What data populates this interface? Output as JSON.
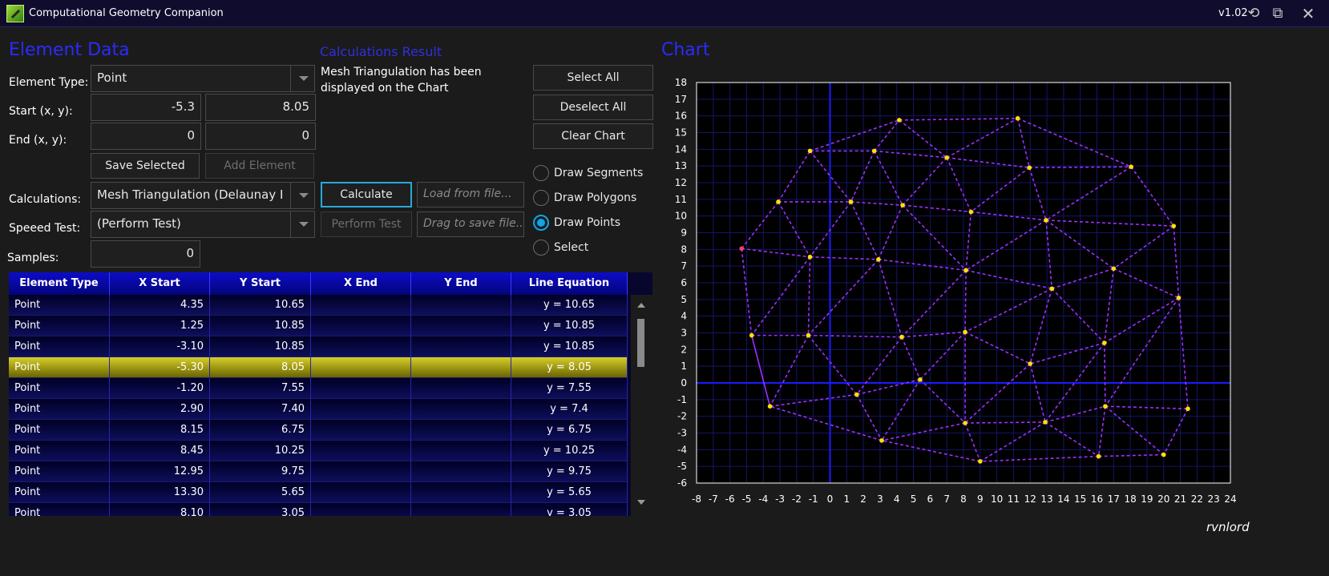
{
  "window": {
    "title": "Computational Geometry Companion",
    "version": "v1.02",
    "controls": [
      "refresh-icon",
      "snap-icon",
      "close-icon"
    ]
  },
  "element_data": {
    "heading": "Element Data",
    "element_type_label": "Element Type:",
    "element_type_value": "Point",
    "start_label": "Start (x, y):",
    "start_x": "-5.3",
    "start_y": "8.05",
    "end_label": "End (x, y):",
    "end_x": "0",
    "end_y": "0",
    "save_selected": "Save Selected",
    "add_element": "Add Element",
    "calculations_label": "Calculations:",
    "calculations_value": "Mesh Triangulation (Delaunay Iterative)",
    "speed_test_label": "Speeed Test:",
    "speed_test_value": "(Perform Test)",
    "samples_label": "Samples:",
    "samples_value": "0"
  },
  "results": {
    "heading": "Calculations Result",
    "message": "Mesh Triangulation has been displayed on the Chart",
    "calculate": "Calculate",
    "perform_test": "Perform Test",
    "load_placeholder": "Load from file...",
    "save_placeholder": "Drag to save file..."
  },
  "actions": {
    "select_all": "Select All",
    "deselect_all": "Deselect All",
    "clear_chart": "Clear Chart",
    "modes": [
      {
        "label": "Draw Segments",
        "checked": false
      },
      {
        "label": "Draw Polygons",
        "checked": false
      },
      {
        "label": "Draw Points",
        "checked": true
      },
      {
        "label": "Select",
        "checked": false
      }
    ]
  },
  "table": {
    "columns": [
      "Element Type",
      "X Start",
      "Y Start",
      "X End",
      "Y End",
      "Line Equation"
    ],
    "rows": [
      [
        "Point",
        "4.35",
        "10.65",
        "",
        "",
        "y = 10.65"
      ],
      [
        "Point",
        "1.25",
        "10.85",
        "",
        "",
        "y = 10.85"
      ],
      [
        "Point",
        "-3.10",
        "10.85",
        "",
        "",
        "y = 10.85"
      ],
      [
        "Point",
        "-5.30",
        "8.05",
        "",
        "",
        "y = 8.05"
      ],
      [
        "Point",
        "-1.20",
        "7.55",
        "",
        "",
        "y = 7.55"
      ],
      [
        "Point",
        "2.90",
        "7.40",
        "",
        "",
        "y = 7.4"
      ],
      [
        "Point",
        "8.15",
        "6.75",
        "",
        "",
        "y = 6.75"
      ],
      [
        "Point",
        "8.45",
        "10.25",
        "",
        "",
        "y = 10.25"
      ],
      [
        "Point",
        "12.95",
        "9.75",
        "",
        "",
        "y = 9.75"
      ],
      [
        "Point",
        "13.30",
        "5.65",
        "",
        "",
        "y = 5.65"
      ],
      [
        "Point",
        "8.10",
        "3.05",
        "",
        "",
        "y = 3.05"
      ]
    ],
    "selected_row": 3
  },
  "chart": {
    "heading": "Chart",
    "author": "rvnlord"
  },
  "colors": {
    "accent": "#2b2bff",
    "edge": "#9b30ff",
    "point": "#ffe100",
    "selected_point": "#ff4060",
    "axis": "#1a1aff",
    "grid": "#15156a"
  },
  "chart_data": {
    "type": "scatter",
    "xlim": [
      -8,
      24
    ],
    "ylim": [
      -6,
      18
    ],
    "x_ticks": [
      -8,
      -7,
      -6,
      -5,
      -4,
      -3,
      -2,
      -1,
      0,
      1,
      2,
      3,
      4,
      5,
      6,
      7,
      8,
      9,
      10,
      11,
      12,
      13,
      14,
      15,
      16,
      17,
      18,
      19,
      20,
      21,
      22,
      23,
      24
    ],
    "y_ticks": [
      -6,
      -5,
      -4,
      -3,
      -2,
      -1,
      0,
      1,
      2,
      3,
      4,
      5,
      6,
      7,
      8,
      9,
      10,
      11,
      12,
      13,
      14,
      15,
      16,
      17,
      18
    ],
    "grid": true,
    "points": [
      [
        -5.3,
        8.05
      ],
      [
        -3.1,
        10.85
      ],
      [
        -1.2,
        13.9
      ],
      [
        2.65,
        13.9
      ],
      [
        4.15,
        15.75
      ],
      [
        11.25,
        15.85
      ],
      [
        7.0,
        13.5
      ],
      [
        11.95,
        12.9
      ],
      [
        18.05,
        12.95
      ],
      [
        1.25,
        10.85
      ],
      [
        4.35,
        10.65
      ],
      [
        8.45,
        10.25
      ],
      [
        12.95,
        9.75
      ],
      [
        20.6,
        9.4
      ],
      [
        -1.2,
        7.55
      ],
      [
        2.9,
        7.4
      ],
      [
        8.15,
        6.75
      ],
      [
        13.3,
        5.65
      ],
      [
        17.0,
        6.85
      ],
      [
        20.9,
        5.1
      ],
      [
        -4.7,
        2.85
      ],
      [
        -1.3,
        2.85
      ],
      [
        4.3,
        2.75
      ],
      [
        8.1,
        3.05
      ],
      [
        16.45,
        2.4
      ],
      [
        12.0,
        1.15
      ],
      [
        5.4,
        0.2
      ],
      [
        1.6,
        -0.7
      ],
      [
        -3.6,
        -1.4
      ],
      [
        8.1,
        -2.4
      ],
      [
        12.9,
        -2.35
      ],
      [
        16.5,
        -1.4
      ],
      [
        21.45,
        -1.55
      ],
      [
        3.1,
        -3.45
      ],
      [
        9.0,
        -4.7
      ],
      [
        16.1,
        -4.4
      ],
      [
        20.0,
        -4.3
      ]
    ],
    "selected_points": [
      [
        -5.3,
        8.05
      ]
    ],
    "edges": [
      [
        0,
        1
      ],
      [
        1,
        2
      ],
      [
        2,
        4
      ],
      [
        4,
        5
      ],
      [
        5,
        8
      ],
      [
        8,
        13
      ],
      [
        13,
        19
      ],
      [
        19,
        32
      ],
      [
        32,
        36
      ],
      [
        36,
        35
      ],
      [
        35,
        34
      ],
      [
        34,
        33
      ],
      [
        33,
        28
      ],
      [
        28,
        20
      ],
      [
        20,
        0
      ],
      [
        2,
        3
      ],
      [
        3,
        4
      ],
      [
        4,
        6
      ],
      [
        6,
        5
      ],
      [
        5,
        7
      ],
      [
        7,
        8
      ],
      [
        3,
        6
      ],
      [
        6,
        7
      ],
      [
        2,
        9
      ],
      [
        3,
        9
      ],
      [
        1,
        9
      ],
      [
        0,
        14
      ],
      [
        1,
        14
      ],
      [
        9,
        14
      ],
      [
        9,
        10
      ],
      [
        3,
        10
      ],
      [
        6,
        10
      ],
      [
        10,
        11
      ],
      [
        6,
        11
      ],
      [
        7,
        11
      ],
      [
        11,
        12
      ],
      [
        7,
        12
      ],
      [
        8,
        12
      ],
      [
        12,
        13
      ],
      [
        12,
        18
      ],
      [
        13,
        18
      ],
      [
        18,
        19
      ],
      [
        10,
        15
      ],
      [
        9,
        15
      ],
      [
        14,
        15
      ],
      [
        15,
        16
      ],
      [
        10,
        16
      ],
      [
        11,
        16
      ],
      [
        12,
        16
      ],
      [
        12,
        17
      ],
      [
        16,
        17
      ],
      [
        17,
        18
      ],
      [
        18,
        24
      ],
      [
        19,
        24
      ],
      [
        14,
        20
      ],
      [
        14,
        21
      ],
      [
        20,
        21
      ],
      [
        15,
        21
      ],
      [
        21,
        22
      ],
      [
        15,
        22
      ],
      [
        16,
        22
      ],
      [
        22,
        23
      ],
      [
        16,
        23
      ],
      [
        17,
        23
      ],
      [
        23,
        25
      ],
      [
        17,
        25
      ],
      [
        17,
        24
      ],
      [
        24,
        25
      ],
      [
        21,
        27
      ],
      [
        20,
        28
      ],
      [
        21,
        28
      ],
      [
        27,
        28
      ],
      [
        22,
        27
      ],
      [
        22,
        26
      ],
      [
        26,
        27
      ],
      [
        23,
        26
      ],
      [
        26,
        29
      ],
      [
        23,
        29
      ],
      [
        25,
        29
      ],
      [
        25,
        30
      ],
      [
        29,
        30
      ],
      [
        24,
        30
      ],
      [
        24,
        31
      ],
      [
        30,
        31
      ],
      [
        31,
        32
      ],
      [
        19,
        31
      ],
      [
        27,
        33
      ],
      [
        26,
        33
      ],
      [
        29,
        33
      ],
      [
        29,
        34
      ],
      [
        30,
        34
      ],
      [
        30,
        35
      ],
      [
        31,
        35
      ],
      [
        31,
        36
      ]
    ]
  }
}
